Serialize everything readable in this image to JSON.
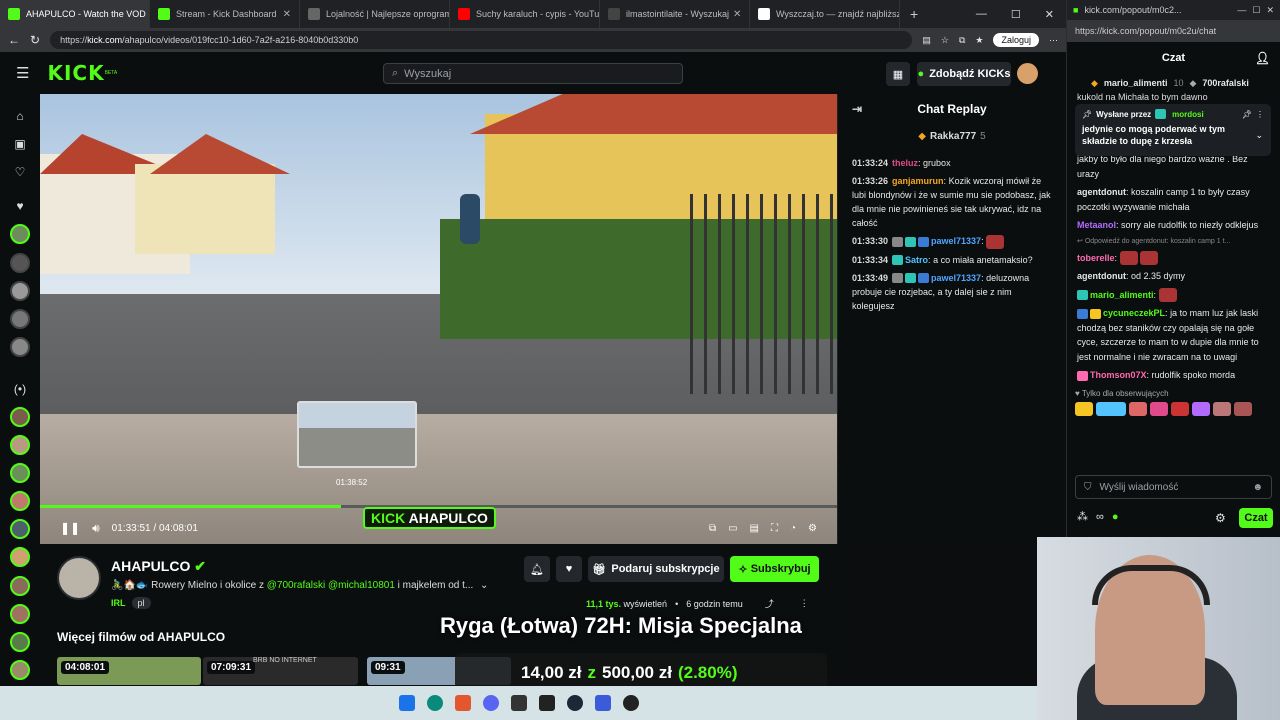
{
  "browser": {
    "tabs": [
      {
        "label": "AHAPULCO - Watch the VOD",
        "active": true,
        "color": "#53fc18"
      },
      {
        "label": "Stream - Kick Dashboard",
        "active": false,
        "color": "#53fc18"
      },
      {
        "label": "Lojalność | Najlepsze oprogram",
        "active": false,
        "color": "#888"
      },
      {
        "label": "Suchy karaluch - cypis - YouTube",
        "active": false,
        "color": "#ff0000"
      },
      {
        "label": "ilmastointilaite - Wyszukaj",
        "active": false,
        "color": "#444"
      },
      {
        "label": "Wyszczaj.to — znajdź najbliższą",
        "active": false,
        "color": "#fff"
      }
    ],
    "url_prefix": "https://",
    "url_host": "kick.com",
    "url_path": "/ahapulco/videos/019fcc10-1d60-7a2f-a216-8040b0d330b0",
    "login_label": "Zaloguj"
  },
  "header": {
    "logo": "KICK",
    "logo_sup": "BETA",
    "search_placeholder": "Wyszukaj",
    "kicks_label": "Zdobądź KICKs"
  },
  "video": {
    "current_time": "01:33:51",
    "total_time": "04:08:01",
    "hover_time": "01:38:52",
    "progress": 0.378,
    "banner_kick": "KICK",
    "banner_name": "AHAPULCO"
  },
  "replay": {
    "title": "Chat Replay",
    "pinned_user": "Rakka777",
    "pinned_count": "5",
    "messages": [
      {
        "time": "01:33:24",
        "user": "theluz",
        "color": "#e04a8c",
        "text": "grubox"
      },
      {
        "time": "01:33:26",
        "user": "ganjamurun",
        "color": "#f5a623",
        "text": "Kozik wczoraj mówił że lubi blondynów i że w sumie mu sie podobasz, jak dla mnie nie powinieneś sie tak ukrywać, idz na całość"
      },
      {
        "time": "01:33:30",
        "user": "pawel71337",
        "color": "#4ea6ff",
        "text": ""
      },
      {
        "time": "01:33:34",
        "user": "Satro",
        "color": "#53c3ff",
        "text": "a co miała anetamaksio?"
      },
      {
        "time": "01:33:49",
        "user": "pawel71337",
        "color": "#4ea6ff",
        "text": "deluzowna probuje cie rozjebac, a ty dalej sie z nim kolegujesz"
      }
    ]
  },
  "channel": {
    "name": "AHAPULCO",
    "description_prefix": "🚴‍♂️🏠🐟 Rowery Mielno i okolice z ",
    "mention1": "@700rafalski",
    "mention2": "@michal10801",
    "description_suffix": " i majkelem od t...",
    "tags": [
      "IRL",
      "pl"
    ],
    "gift_label": "Podaruj subskrypcje",
    "subscribe_label": "Subskrybuj",
    "views": "11,1 tys.",
    "views_label": "wyświetleń",
    "ago": "6 godzin temu",
    "more_videos": "Więcej filmów od AHAPULCO",
    "thumbs": [
      {
        "duration": "04:08:01",
        "color": "#7a9a55"
      },
      {
        "duration": "07:09:31",
        "color": "#2a2a2a"
      },
      {
        "duration": "09:31",
        "color": "#8aa0b5"
      }
    ],
    "thumb_overlay": "BRB NO INTERNET"
  },
  "overlay": {
    "title": "Ryga (Łotwa) 72H: Misja Specjalna",
    "donation_current": "14,00 zł",
    "donation_sep": "z",
    "donation_goal": "500,00 zł",
    "donation_pct": "(2.80%)"
  },
  "popout": {
    "tab_label": "kick.com/popout/m0c2...",
    "url": "https://kick.com/popout/m0c2u/chat",
    "title": "Czat",
    "top_user1": "mario_alimenti",
    "top_user1_count": "10",
    "top_user2": "700rafalski",
    "pinned_sender_label": "Wysłane przez",
    "pinned_sender": "mordosi",
    "pinned_text": "jedynie co mogą poderwać w tym składzie to dupę z krzesła",
    "pinned_bg_text": "kukold na Michała to bym dawno",
    "messages": [
      {
        "user": "",
        "color": "#fff",
        "text": "jakby to było dla niego bardzo ważne . Bez urazy"
      },
      {
        "user": "agentdonut",
        "color": "#e6e6e6",
        "text": "koszalin camp 1 to były czasy poczotki wyzywanie michała"
      },
      {
        "user": "Metaanol",
        "color": "#b26bff",
        "text": "sorry ale rudolfik to niezły odklejus"
      },
      {
        "user": "toberelle",
        "color": "#ff6ab0",
        "text": "",
        "reply": "Odpowiedź do agentdonut: koszalin camp 1 t..."
      },
      {
        "user": "agentdonut",
        "color": "#e6e6e6",
        "text": "od 2.35 dymy"
      },
      {
        "user": "mario_alimenti",
        "color": "#53fc18",
        "text": ""
      },
      {
        "user": "cycuneczekPL",
        "color": "#53fc18",
        "text": "ja to mam luz jak laski chodzą bez staników czy opalają się na gołe cyce, szczerze to mam to w dupie dla mnie to jest normalne i nie zwracam na to uwagi"
      },
      {
        "user": "Thomson07X",
        "color": "#ff6ab0",
        "text": "rudolfik spoko morda"
      }
    ],
    "followers_only": "Tylko dla obserwujących",
    "input_placeholder": "Wyślij wiadomość",
    "send_label": "Czat"
  },
  "colors": {
    "accent": "#53fc18",
    "bg": "#0b0e0f"
  }
}
